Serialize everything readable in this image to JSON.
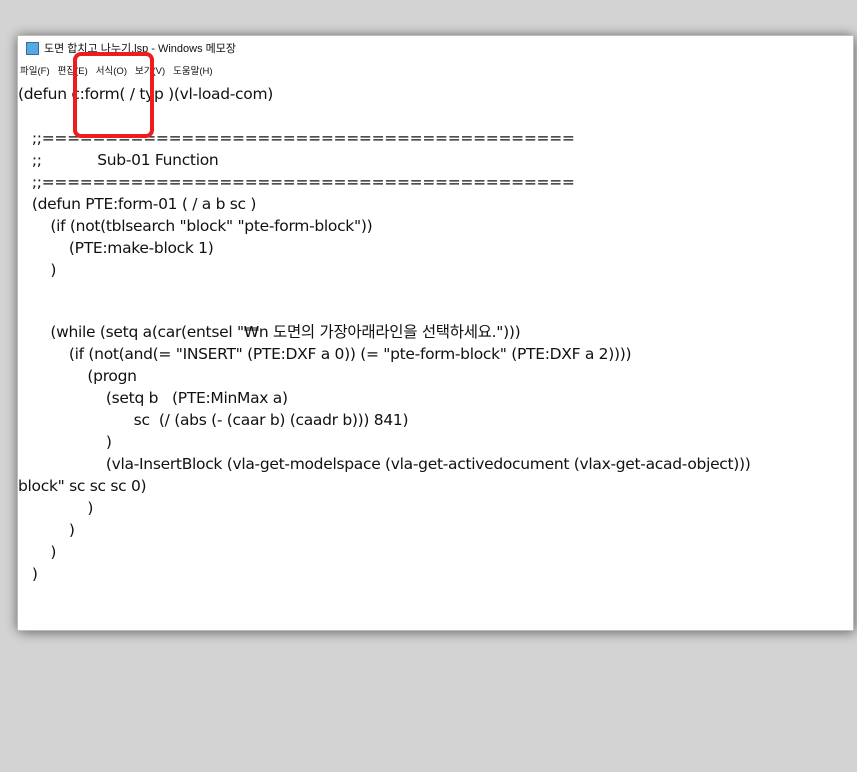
{
  "window": {
    "title": "도면 합치고 나누기.lsp - Windows 메모장",
    "app_icon": "notepad-icon"
  },
  "menu": [
    {
      "label": "파일(F)"
    },
    {
      "label": "편집(E)"
    },
    {
      "label": "서식(O)"
    },
    {
      "label": "보기(V)"
    },
    {
      "label": "도움말(H)"
    }
  ],
  "code_lines": [
    "(defun c:form( / typ )(vl-load-com)",
    "",
    "   ;;==========================================",
    "   ;;            Sub-01 Function",
    "   ;;==========================================",
    "   (defun PTE:form-01 ( / a b sc )",
    "       (if (not(tblsearch \"block\" \"pte-form-block\"))",
    "           (PTE:make-block 1)",
    "       )",
    "",
    "       (while (setq a(car(entsel \"₩n 도면의 가장아래라인을 선택하세요.\")))",
    "           (if (not(and(= \"INSERT\" (PTE:DXF a 0)) (= \"pte-form-block\" (PTE:DXF a 2))))",
    "               (progn",
    "                   (setq b   (PTE:MinMax a)",
    "                         sc  (/ (abs (- (caar b) (caadr b))) 841)",
    "                   )",
    "                   (vla-InsertBlock (vla-get-modelspace (vla-get-activedocument (vlax-get-acad-object)))",
    "block\" sc sc sc 0)",
    "               )",
    "           )",
    "       )",
    "   )"
  ],
  "annotation": {
    "color": "#ee1c1c"
  }
}
